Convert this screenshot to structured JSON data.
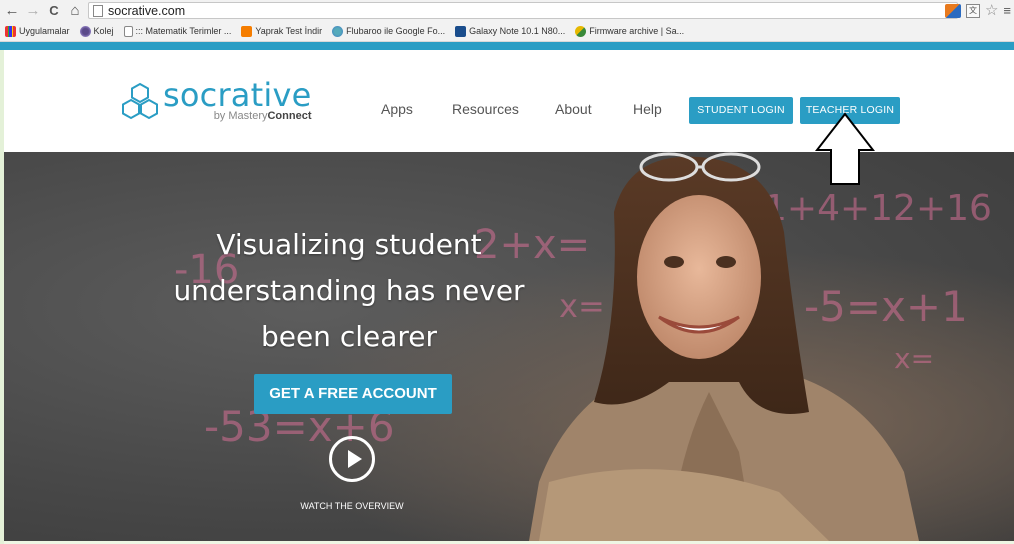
{
  "browser": {
    "back_glyph": "←",
    "forward_glyph": "→",
    "reload_glyph": "C",
    "home_glyph": "⌂",
    "url": "socrative.com",
    "star_glyph": "☆",
    "menu_glyph": "≡",
    "translate_glyph": "文"
  },
  "bookmarks": [
    {
      "label": "Uygulamalar",
      "icon": "apps-icon"
    },
    {
      "label": "Kolej",
      "icon": "kolej-icon"
    },
    {
      "label": "::: Matematik Terimler ...",
      "icon": "page-icon"
    },
    {
      "label": "Yaprak Test İndir",
      "icon": "blogger-icon"
    },
    {
      "label": "Flubaroo ile Google Fo...",
      "icon": "flubaroo-icon"
    },
    {
      "label": "Galaxy Note 10.1 N80...",
      "icon": "tj-icon"
    },
    {
      "label": "Firmware archive | Sa...",
      "icon": "firmware-icon"
    }
  ],
  "header": {
    "logo_word": "socrative",
    "logo_tag_prefix": "by Mastery",
    "logo_tag_bold": "Connect",
    "nav": [
      "Apps",
      "Resources",
      "About",
      "Help"
    ],
    "student_login": "STUDENT LOGIN",
    "teacher_login": "TEACHER LOGIN"
  },
  "hero": {
    "title_line1": "Visualizing student",
    "title_line2": "understanding has never",
    "title_line3": "been clearer",
    "cta": "GET A FREE ACCOUNT",
    "watch": "WATCH THE OVERVIEW"
  },
  "colors": {
    "brand": "#2a9dc4",
    "chrome": "#f2f2f2",
    "hero_bg": "#474747"
  }
}
